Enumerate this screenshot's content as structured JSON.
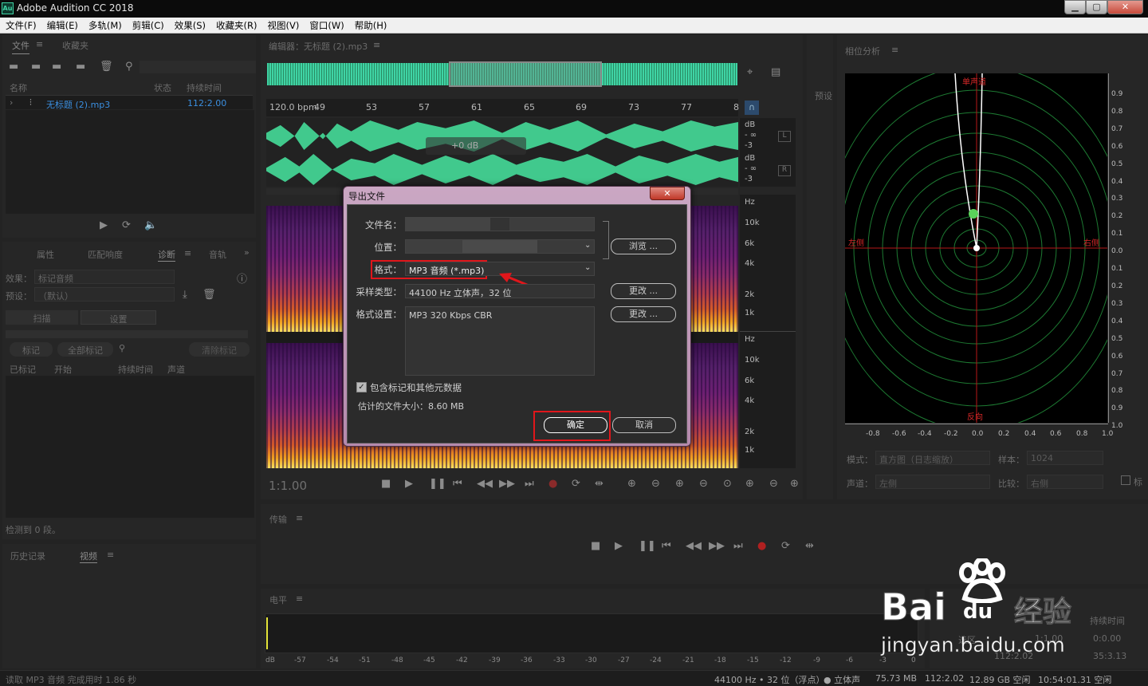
{
  "app": {
    "title": "Adobe Audition CC 2018",
    "logo": "Au",
    "window_controls": {
      "minimize": "▁",
      "maximize": "▢",
      "close": "✕"
    }
  },
  "menu": [
    "文件(F)",
    "编辑(E)",
    "多轨(M)",
    "剪辑(C)",
    "效果(S)",
    "收藏夹(R)",
    "视图(V)",
    "窗口(W)",
    "帮助(H)"
  ],
  "files_panel": {
    "tabs": [
      "文件",
      "收藏夹"
    ],
    "col_name": "名称",
    "col_status": "状态",
    "col_duration": "持续时间",
    "file": {
      "name": "无标题 (2).mp3",
      "duration": "112:2.00"
    }
  },
  "props_panel": {
    "tabs": [
      "属性",
      "匹配响度",
      "诊断",
      "音轨"
    ],
    "effect_label": "效果：",
    "effect_value": "标记音频",
    "preset_label": "预设：",
    "preset_value": "（默认）",
    "scan_btn": "扫描",
    "settings_btn": "设置",
    "marker_btn": "标记",
    "all_markers_btn": "全部标记",
    "clear_btn": "清除标记",
    "cols": [
      "已标记",
      "开始",
      "持续时间",
      "声道"
    ],
    "detected": "检测到 0 段。"
  },
  "history_panel": {
    "tabs": [
      "历史记录",
      "视频"
    ]
  },
  "editor": {
    "title": "编辑器：无标题 (2).mp3",
    "bpm": "120.0 bpm",
    "ruler": [
      "49",
      "53",
      "57",
      "61",
      "65",
      "69",
      "73",
      "77",
      "8"
    ],
    "time": "1:1.00",
    "db_top": [
      "dB",
      "- ∞",
      "-3"
    ],
    "db_bot": [
      "dB",
      "- ∞",
      "-3"
    ],
    "ch_l": "L",
    "ch_r": "R",
    "hz_top": [
      "Hz",
      "10k",
      "6k",
      "4k",
      "2k",
      "1k"
    ],
    "hz_bot": [
      "Hz",
      "10k",
      "6k",
      "4k",
      "2k",
      "1k"
    ],
    "hud": "+0 dB"
  },
  "presets_label": "预设",
  "dialog": {
    "title": "导出文件",
    "filename_label": "文件名：",
    "location_label": "位置：",
    "format_label": "格式：",
    "format_value": "MP3 音频 (*.mp3)",
    "sample_label": "采样类型：",
    "sample_value": "44100 Hz 立体声，32 位",
    "fmtset_label": "格式设置：",
    "fmtset_value": "MP3 320 Kbps CBR",
    "browse_btn": "浏览 ...",
    "change_btn1": "更改 ...",
    "change_btn2": "更改 ...",
    "include_label": "包含标记和其他元数据",
    "filesize_label": "估计的文件大小：8.60 MB",
    "ok_btn": "确定",
    "cancel_btn": "取消"
  },
  "phase": {
    "title": "相位分析",
    "mono": "单声道",
    "left": "左侧",
    "right": "右侧",
    "inverse": "反向",
    "right_scale": [
      "0.9",
      "0.8",
      "0.7",
      "0.6",
      "0.5",
      "0.4",
      "0.3",
      "0.2",
      "0.1",
      "0.0",
      "0.1",
      "0.2",
      "0.3",
      "0.4",
      "0.5",
      "0.6",
      "0.7",
      "0.8",
      "0.9",
      "1.0"
    ],
    "bottom_scale": [
      "-0.8",
      "-0.6",
      "-0.4",
      "-0.2",
      "0.0",
      "0.2",
      "0.4",
      "0.6",
      "0.8",
      "1.0"
    ],
    "mode_label": "模式：",
    "mode_value": "直方图（日志缩放）",
    "sample_label": "样本：",
    "sample_value": "1024",
    "channel_label": "声道：",
    "channel_value": "左侧",
    "compare_label": "比较：",
    "compare_value": "右侧",
    "extra": "标"
  },
  "transport": {
    "title": "传输"
  },
  "levels": {
    "title": "电平",
    "ticks": [
      "dB",
      "-57",
      "-54",
      "-51",
      "-48",
      "-45",
      "-42",
      "-39",
      "-36",
      "-33",
      "-30",
      "-27",
      "-24",
      "-21",
      "-18",
      "-15",
      "-12",
      "-9",
      "-6",
      "-3",
      "0"
    ]
  },
  "selection": {
    "duration": "持续时间",
    "region_label": "选区",
    "rows": [
      "1:1.00",
      "0:0.00",
      "112:2.02",
      "35:3.13"
    ]
  },
  "watermark": {
    "brand": "Bai",
    "du": "du",
    "cn": "经验",
    "url": "jingyan.baidu.com"
  },
  "status": {
    "left": "读取 MP3 音频 完成用时 1.86 秒",
    "items": [
      "44100 Hz • 32 位（浮点）",
      "● 立体声",
      "75.73 MB",
      "112:2.02",
      "12.89 GB 空闲",
      "10:54:01.31 空闲"
    ]
  },
  "colors": {
    "accent": "#3fd4a5",
    "highlight": "#e0161b",
    "link": "#3b8fe0"
  }
}
